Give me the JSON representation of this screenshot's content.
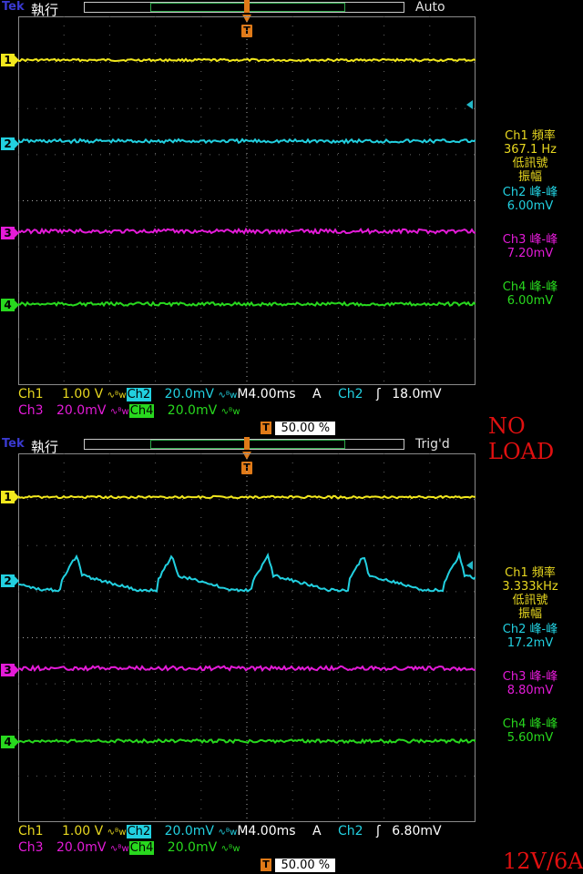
{
  "screens": [
    {
      "brand": "Tek",
      "run_state": "執行",
      "trigger_state": "Auto",
      "trigger_marker": "T",
      "channel_markers": [
        "1",
        "2",
        "3",
        "4"
      ],
      "readouts": {
        "ch1": {
          "title": "Ch1 頻率",
          "value": "367.1 Hz",
          "note1": "低訊號",
          "note2": "振幅"
        },
        "ch2": {
          "title": "Ch2 峰-峰",
          "value": "6.00mV"
        },
        "ch3": {
          "title": "Ch3 峰-峰",
          "value": "7.20mV"
        },
        "ch4": {
          "title": "Ch4 峰-峰",
          "value": "6.00mV"
        }
      },
      "status": {
        "ch1_label": "Ch1",
        "ch1_scale": "1.00 V",
        "ch2_label": "Ch2",
        "ch2_scale": "20.0mV",
        "ch3_label": "Ch3",
        "ch3_scale": "20.0mV",
        "ch4_label": "Ch4",
        "ch4_scale": "20.0mV",
        "coupling_symbol": "∿ᴮw",
        "timebase": "M4.00ms",
        "trigger_mode": "A",
        "trigger_source": "Ch2",
        "trigger_slope": "ʃ",
        "trigger_level": "18.0mV",
        "trigger_position_icon": "T",
        "trigger_position": "50.00 %"
      },
      "annotation": "NO LOAD",
      "colors": {
        "ch1": "#f2e81d",
        "ch2": "#22d0e0",
        "ch3": "#e41bd8",
        "ch4": "#28d81e"
      },
      "ch2_waveform": "flat"
    },
    {
      "brand": "Tek",
      "run_state": "執行",
      "trigger_state": "Trig'd",
      "trigger_marker": "T",
      "channel_markers": [
        "1",
        "2",
        "3",
        "4"
      ],
      "readouts": {
        "ch1": {
          "title": "Ch1 頻率",
          "value": "3.333kHz",
          "note1": "低訊號",
          "note2": "振幅"
        },
        "ch2": {
          "title": "Ch2 峰-峰",
          "value": "17.2mV"
        },
        "ch3": {
          "title": "Ch3 峰-峰",
          "value": "8.80mV"
        },
        "ch4": {
          "title": "Ch4 峰-峰",
          "value": "5.60mV"
        }
      },
      "status": {
        "ch1_label": "Ch1",
        "ch1_scale": "1.00 V",
        "ch2_label": "Ch2",
        "ch2_scale": "20.0mV",
        "ch3_label": "Ch3",
        "ch3_scale": "20.0mV",
        "ch4_label": "Ch4",
        "ch4_scale": "20.0mV",
        "coupling_symbol": "∿ᴮw",
        "timebase": "M4.00ms",
        "trigger_mode": "A",
        "trigger_source": "Ch2",
        "trigger_slope": "ʃ",
        "trigger_level": "6.80mV",
        "trigger_position_icon": "T",
        "trigger_position": "50.00 %"
      },
      "annotation": "12V/6A",
      "colors": {
        "ch1": "#f2e81d",
        "ch2": "#22d0e0",
        "ch3": "#e41bd8",
        "ch4": "#28d81e"
      },
      "ch2_waveform": "sawtooth"
    }
  ]
}
